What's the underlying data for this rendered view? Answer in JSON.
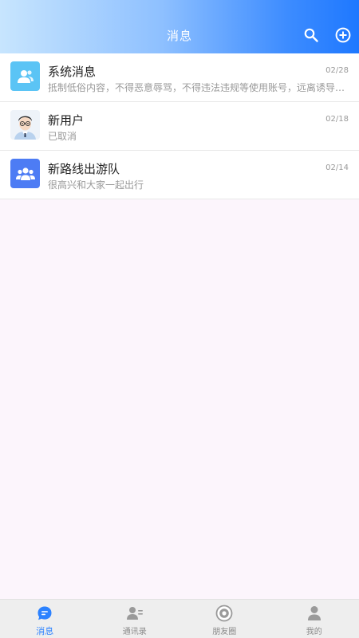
{
  "header": {
    "title": "消息",
    "search_icon": "search-icon",
    "add_icon": "plus-circle-icon"
  },
  "conversations": [
    {
      "name": "系统消息",
      "preview": "抵制低俗内容，不得恶意辱骂，不得违法违规等使用账号，远离诱导…",
      "time": "02/28",
      "avatar_icon": "system-user-icon",
      "avatar_color": "#5bc4f5"
    },
    {
      "name": "新用户",
      "preview": "已取消",
      "time": "02/18",
      "avatar_icon": "user-portrait-icon",
      "avatar_color": "#eef3f9"
    },
    {
      "name": "新路线出游队",
      "preview": "很高兴和大家一起出行",
      "time": "02/14",
      "avatar_icon": "group-icon",
      "avatar_color": "#4d7cf4"
    }
  ],
  "bottom_nav": [
    {
      "label": "消息",
      "icon": "chat-icon",
      "active": true
    },
    {
      "label": "通讯录",
      "icon": "contacts-icon",
      "active": false
    },
    {
      "label": "朋友圈",
      "icon": "moments-icon",
      "active": false
    },
    {
      "label": "我的",
      "icon": "profile-icon",
      "active": false
    }
  ],
  "colors": {
    "accent": "#2c82ff",
    "background": "#fcf5fc",
    "nav_background": "#eeeeee"
  }
}
